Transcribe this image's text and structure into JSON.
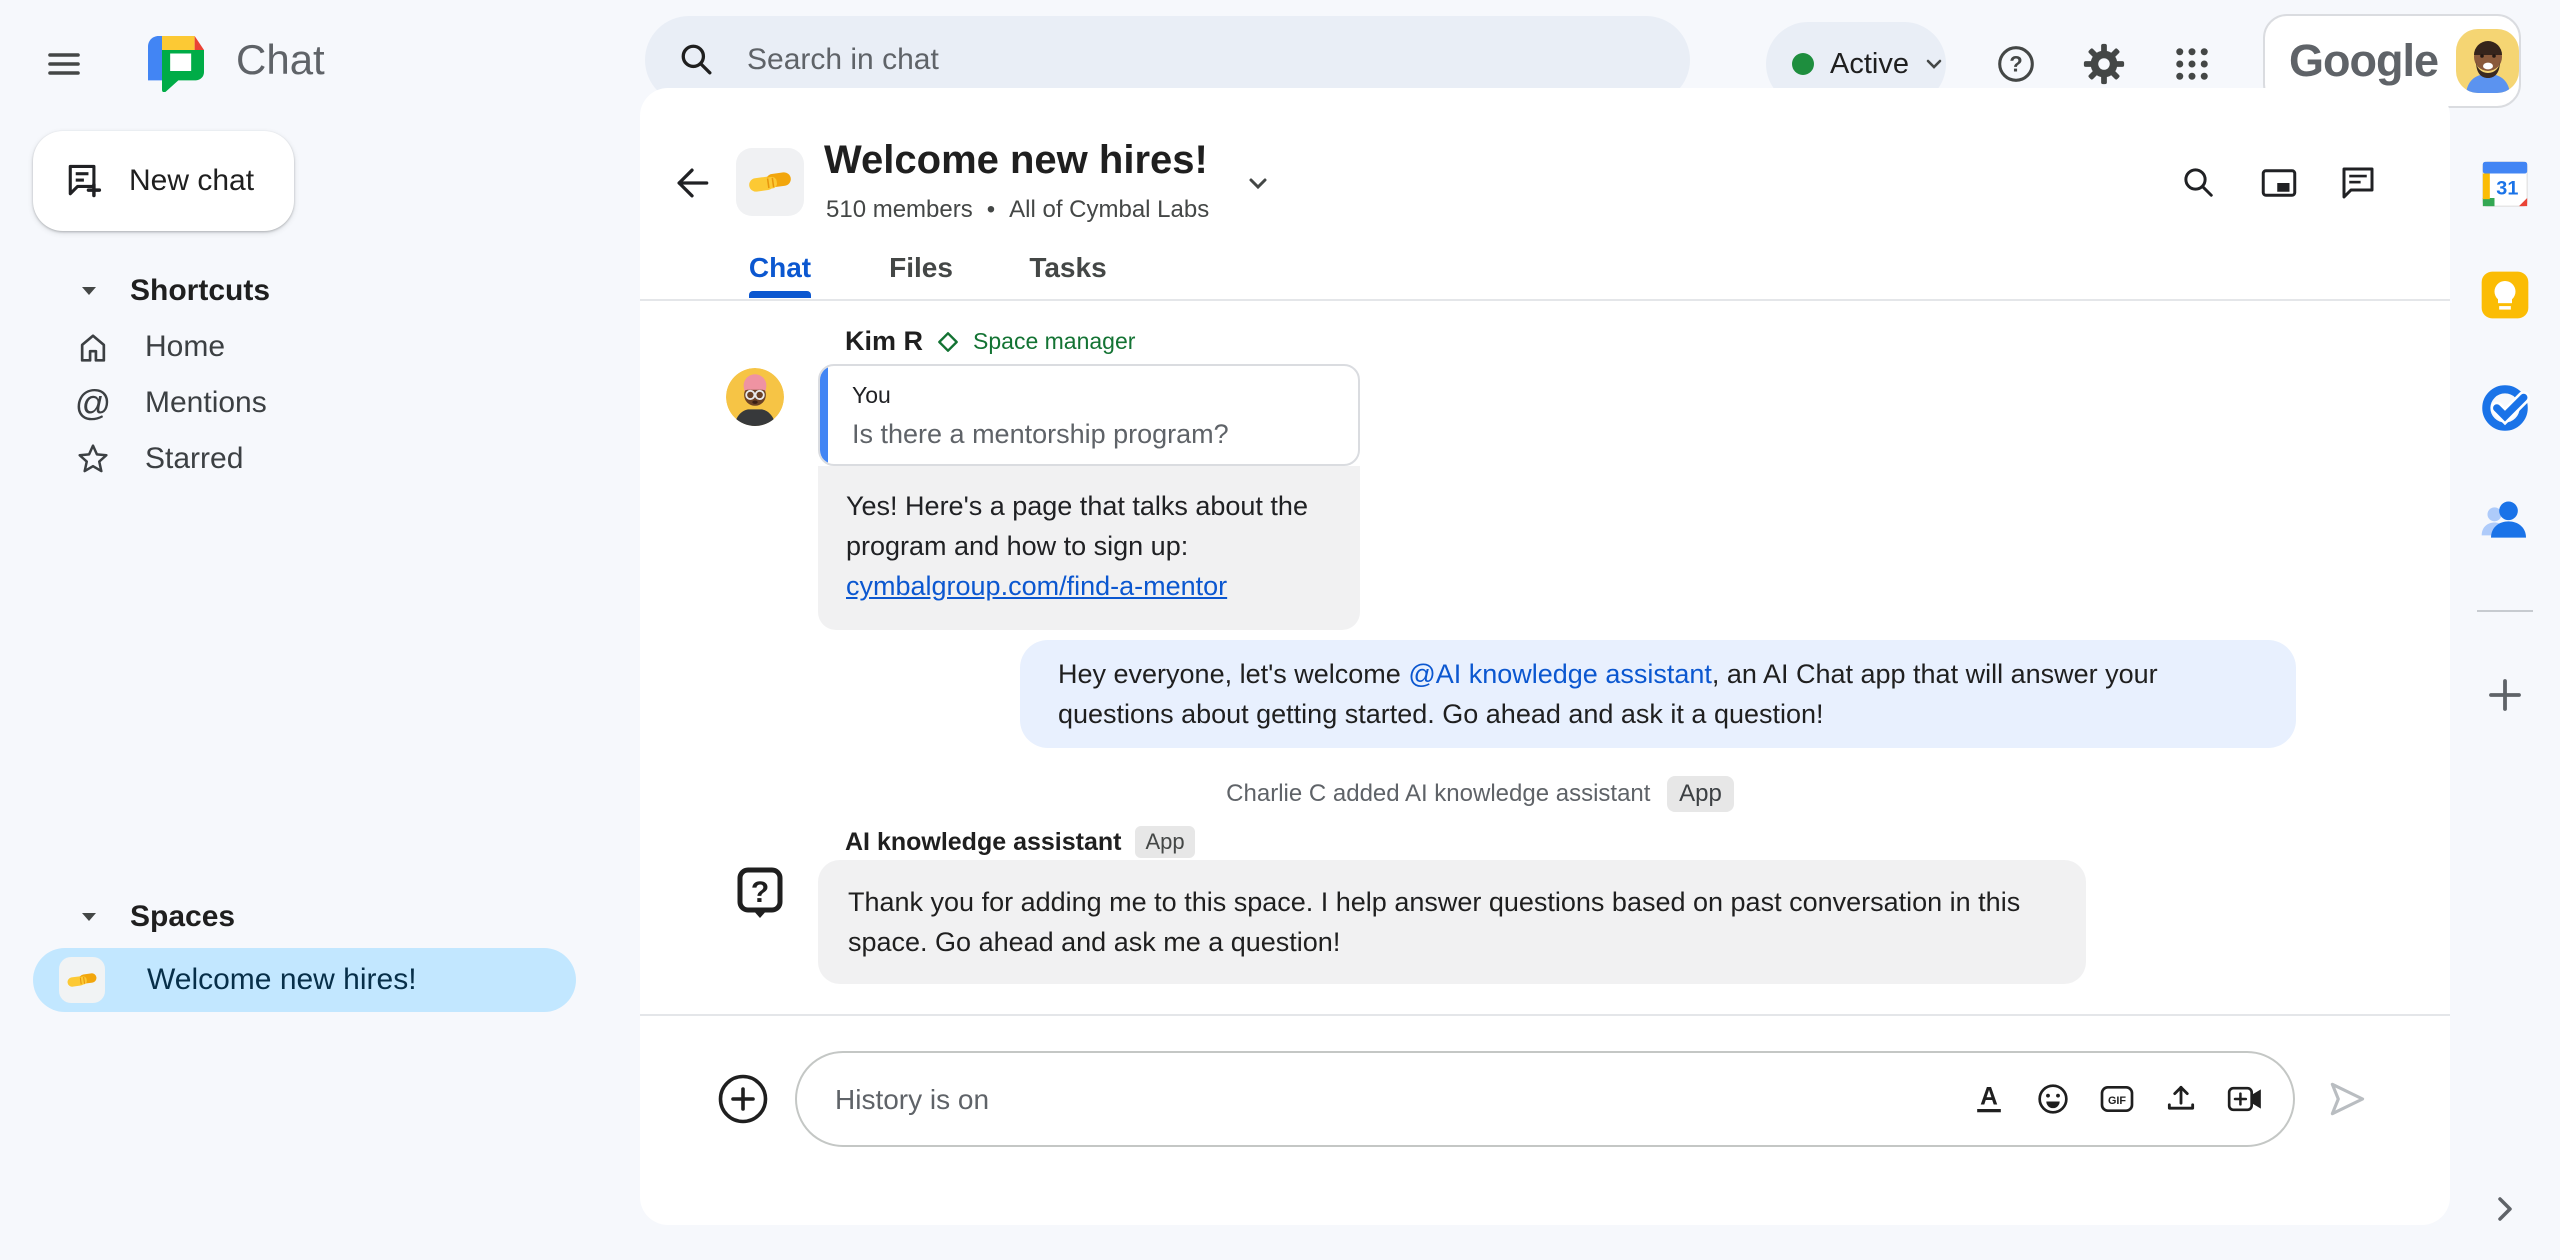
{
  "topbar": {
    "app_name": "Chat",
    "search_placeholder": "Search in chat",
    "status_label": "Active",
    "google_logo": "Google",
    "help_glyph": "?"
  },
  "sidebar": {
    "new_chat_label": "New chat",
    "shortcuts": {
      "label": "Shortcuts",
      "items": [
        {
          "label": "Home"
        },
        {
          "label": "Mentions"
        },
        {
          "label": "Starred"
        }
      ]
    },
    "spaces": {
      "label": "Spaces",
      "items": [
        {
          "label": "Welcome new hires!"
        }
      ]
    }
  },
  "space_header": {
    "title": "Welcome new hires!",
    "members": "510 members",
    "separator": "•",
    "org": "All of Cymbal Labs",
    "tabs": [
      {
        "label": "Chat"
      },
      {
        "label": "Files"
      },
      {
        "label": "Tasks"
      }
    ]
  },
  "messages": {
    "kim": {
      "name": "Kim R",
      "role": "Space manager",
      "quote_author": "You",
      "quote_text": "Is there a mentorship program?",
      "reply_text": "Yes! Here's a page that talks about the program and how to sign up:",
      "reply_link": "cymbalgroup.com/find-a-mentor"
    },
    "announcement": {
      "before": "Hey everyone, let's welcome ",
      "mention": "@AI knowledge assistant",
      "after": ", an AI Chat app that will answer your questions about getting started.  Go ahead and ask it a question!"
    },
    "system": {
      "text": "Charlie C added AI knowledge assistant",
      "badge": "App"
    },
    "assistant": {
      "name": "AI knowledge assistant",
      "badge": "App",
      "avatar_glyph": "?",
      "text": "Thank you for adding me to this space. I help answer questions based on past conversation in this space. Go ahead and ask me a question!"
    }
  },
  "compose": {
    "placeholder": "History is on",
    "gif_label": "GIF"
  },
  "rightbar": {
    "calendar_day": "31"
  },
  "icons_glyphs": {
    "mentions": "@"
  },
  "colors": {
    "accent_blue": "#0b57d0",
    "mention_blue": "#0b57d0",
    "bubble_blue": "#e8f0fe",
    "bubble_gray": "#f1f1f2",
    "selected_space_bg": "#c2e7ff",
    "status_green": "#1e8e3e",
    "role_green": "#137333",
    "page_bg": "#f6f8fc",
    "pill_bg": "#e9eef6"
  }
}
